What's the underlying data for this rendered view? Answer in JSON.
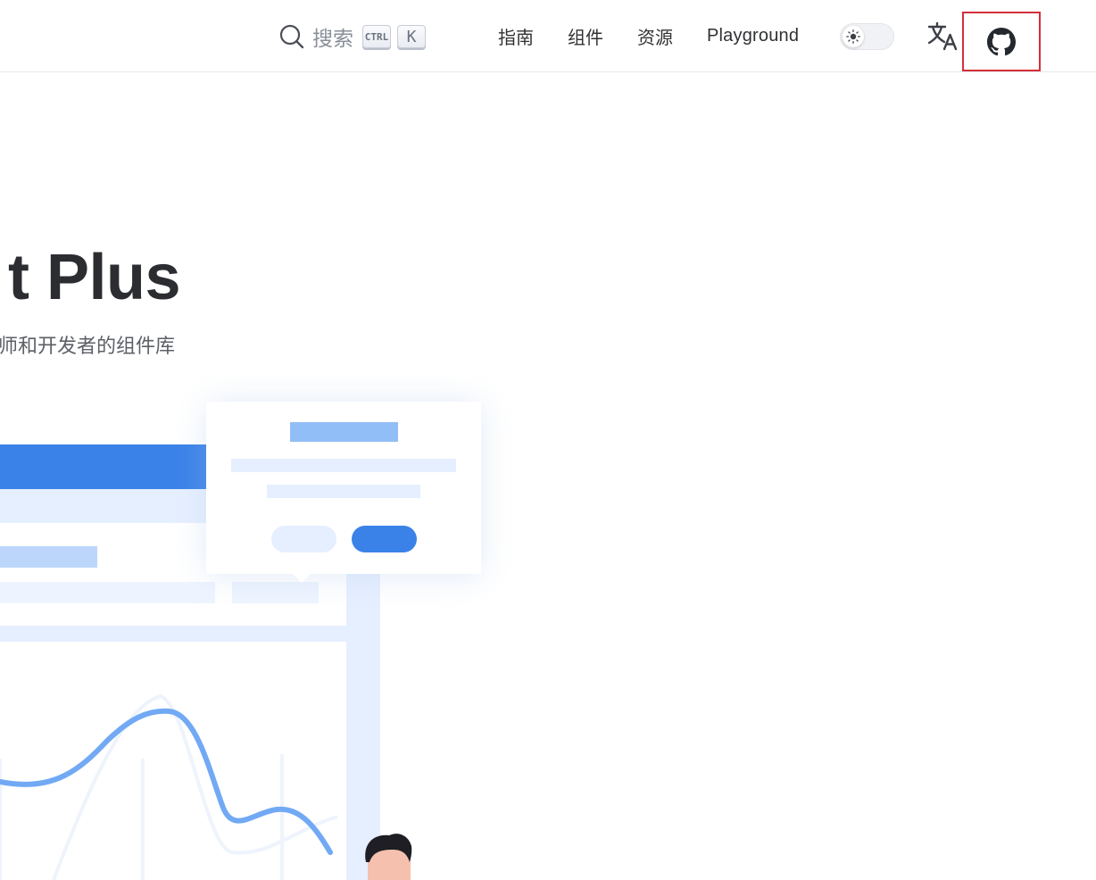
{
  "header": {
    "search": {
      "label": "搜索",
      "shortcut_ctrl": "CTRL",
      "shortcut_key": "K"
    },
    "nav": {
      "guide": "指南",
      "component": "组件",
      "resource": "资源",
      "playground": "Playground"
    },
    "theme_toggle": {
      "state": "light",
      "icon": "sun-icon"
    },
    "language_icon": "translate-icon",
    "github_icon": "github-icon"
  },
  "hero": {
    "title": "t Plus",
    "subtitle": "师和开发者的组件库"
  },
  "colors": {
    "primary": "#3b82e8",
    "primary_light": "#92bef7",
    "panel_light": "#e6efff",
    "text_dark": "#2b2d31",
    "highlight_border": "#d32f3a"
  }
}
